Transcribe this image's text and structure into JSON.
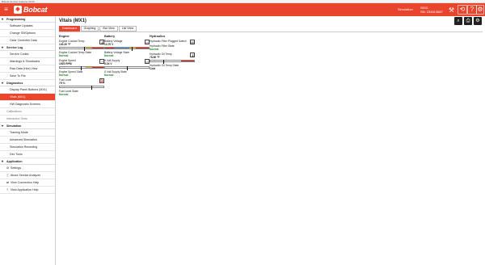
{
  "window": {
    "title": "Bobcat Service Analyzer 00.00"
  },
  "header": {
    "logo_text": "Bobcat",
    "simulation_label": "Simulation",
    "model": "S510",
    "serial": "SN: 234613887",
    "brand_color": "#e8452c"
  },
  "header_buttons": {
    "refresh": "⟲",
    "help": "?",
    "settings": "⚙"
  },
  "top_icons": {
    "search": "⌕",
    "print": "⎙",
    "config": "⚙"
  },
  "sidebar": {
    "sections": [
      {
        "label": "Programming",
        "items": [
          "Software Updates",
          "Change SN/Options",
          "Clear Controller Data"
        ]
      },
      {
        "label": "Service Log",
        "items": [
          "Service Codes",
          "Warnings & Shutdowns",
          "Raw Data (Hex) View",
          "Save To File"
        ]
      },
      {
        "label": "Diagnostics",
        "items": [
          "Display Panel Buttons (MX1)",
          "Vitals (MX1)",
          "HW Diagnostic Screens"
        ]
      }
    ],
    "extra_items": [
      "Calibrations",
      "Interactive Tests"
    ],
    "simulation": {
      "label": "Simulation",
      "items": [
        "Training Mode",
        "Advanced Simulation",
        "Simulation Recording",
        "Dev Tools"
      ]
    },
    "application": {
      "label": "Application",
      "items": [
        "Settings",
        "About Service Analyzer",
        "View Connection Help",
        "View Application Help"
      ]
    },
    "active_item": "Vitals (MX1)"
  },
  "main": {
    "title": "Vitals (MX1)",
    "tabs": [
      "Dashboard",
      "Graphing",
      "Bar View",
      "List View"
    ],
    "active_tab": "Dashboard"
  },
  "engine": {
    "header": "Engine",
    "coolant_temp": {
      "label": "Engine Coolant Temp",
      "value": "140.30 °F",
      "needle": 0.55
    },
    "coolant_state": {
      "label": "Engine Coolant Temp State",
      "value": "Normal"
    },
    "speed": {
      "label": "Engine Speed",
      "value": "1925 RPM",
      "needle": 0.48
    },
    "speed_state": {
      "label": "Engine Speed State",
      "value": "Normal"
    },
    "fuel": {
      "label": "Fuel Level",
      "value": "75 %",
      "needle": 0.72
    },
    "fuel_state": {
      "label": "Fuel Level State",
      "value": "Normal"
    }
  },
  "battery": {
    "header": "Battery",
    "voltage": {
      "label": "Battery Voltage",
      "value": "13.70 V",
      "needle": 0.62
    },
    "voltage_state": {
      "label": "Battery Voltage State",
      "value": "Normal"
    },
    "supply": {
      "label": "8 Volt Supply",
      "value": "8.04 V",
      "needle": 0.5
    },
    "supply_state": {
      "label": "8 Volt Supply State",
      "value": "Normal"
    }
  },
  "hydraulics": {
    "header": "Hydraulics",
    "filter": {
      "label": "Hydraulic Filter Plugged Switch",
      "value": ""
    },
    "filter_state": {
      "label": "Hydraulic Filter State",
      "value": "Normal"
    },
    "oil_temp": {
      "label": "Hydraulic Oil Temp",
      "value": "78.80 °F",
      "needle": 0.3
    },
    "oil_state": {
      "label": "Hydraulic Oil Temp State",
      "value": "Cold"
    }
  }
}
